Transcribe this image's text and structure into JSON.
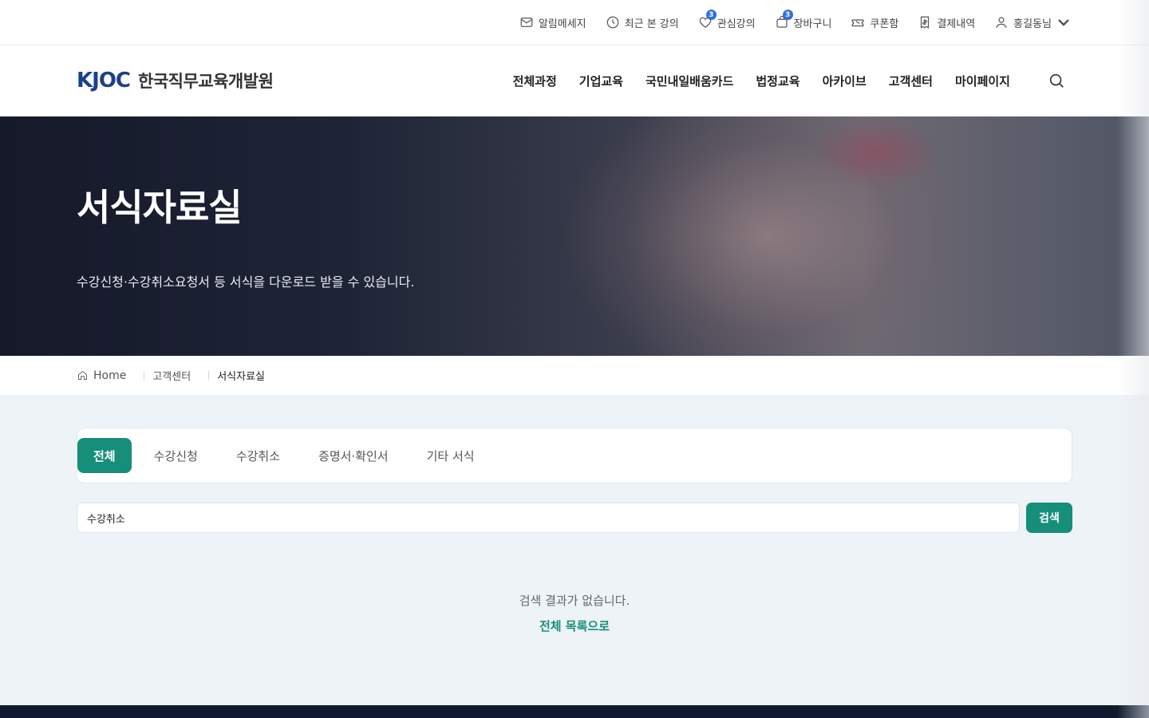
{
  "utility_bar": {
    "items": [
      {
        "label": "알림메세지",
        "icon": "mail-icon"
      },
      {
        "label": "최근 본 강의",
        "icon": "clock-icon"
      },
      {
        "label": "관심강의",
        "icon": "heart-icon",
        "badge": "3"
      },
      {
        "label": "장바구니",
        "icon": "shopping-bag-icon",
        "badge": "3"
      },
      {
        "label": "쿠폰함",
        "icon": "ticket-icon"
      },
      {
        "label": "결제내역",
        "icon": "receipt-icon"
      },
      {
        "label": "홍길동님",
        "icon": "user-icon"
      }
    ]
  },
  "header": {
    "logo_mark": "KJOC",
    "logo_text": "한국직무교육개발원",
    "nav": [
      "전체과정",
      "기업교육",
      "국민내일배움카드",
      "법정교육",
      "아카이브",
      "고객센터",
      "마이페이지"
    ]
  },
  "hero": {
    "title": "서식자료실",
    "description": "수강신청·수강취소요청서 등 서식을 다운로드 받을 수 있습니다."
  },
  "breadcrumb": {
    "home": "Home",
    "section": "고객센터",
    "current": "서식자료실"
  },
  "tabs": [
    {
      "label": "전체",
      "active": true
    },
    {
      "label": "수강신청",
      "active": false
    },
    {
      "label": "수강취소",
      "active": false
    },
    {
      "label": "증명서·확인서",
      "active": false
    },
    {
      "label": "기타 서식",
      "active": false
    }
  ],
  "search": {
    "value": "수강취소",
    "button_label": "검색"
  },
  "empty_state": {
    "message": "검색 결과가 없습니다.",
    "back_link": "전체 목록으로"
  },
  "colors": {
    "accent": "#178e7a",
    "brand": "#1b3f8f",
    "badge": "#2f6fe4"
  }
}
